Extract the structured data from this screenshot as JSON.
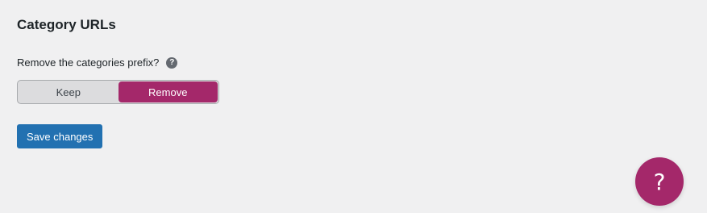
{
  "section": {
    "title": "Category URLs"
  },
  "field": {
    "label": "Remove the categories prefix?",
    "help_icon": "question-mark-icon",
    "help_glyph": "?"
  },
  "toggle": {
    "options": [
      {
        "label": "Keep",
        "active": false
      },
      {
        "label": "Remove",
        "active": true
      }
    ],
    "active_color": "#a4286a"
  },
  "actions": {
    "save_label": "Save changes",
    "save_color": "#2271b1"
  },
  "help_fab": {
    "icon": "question-mark-icon",
    "glyph": "?",
    "color": "#a4286a"
  }
}
